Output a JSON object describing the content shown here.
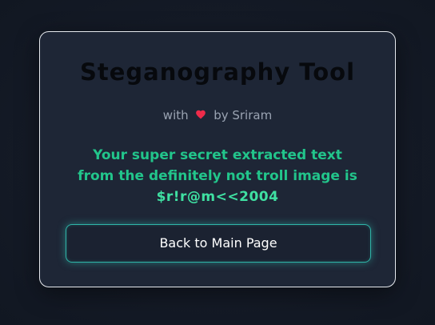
{
  "card": {
    "title": "Steganography Tool",
    "byline_prefix": "with",
    "heart_icon": "heart-icon",
    "heart_color": "#ef2b4a",
    "byline_suffix": "by Sriram",
    "message_line1": "Your super secret extracted text",
    "message_line2": "from the definitely not troll image is",
    "secret_text": "$r!r@m<<2004",
    "back_button_label": "Back to Main Page"
  },
  "colors": {
    "background": "#141a26",
    "card_background": "#1e2636",
    "accent_green": "#22c58b",
    "button_glow": "#2fb5a8"
  }
}
